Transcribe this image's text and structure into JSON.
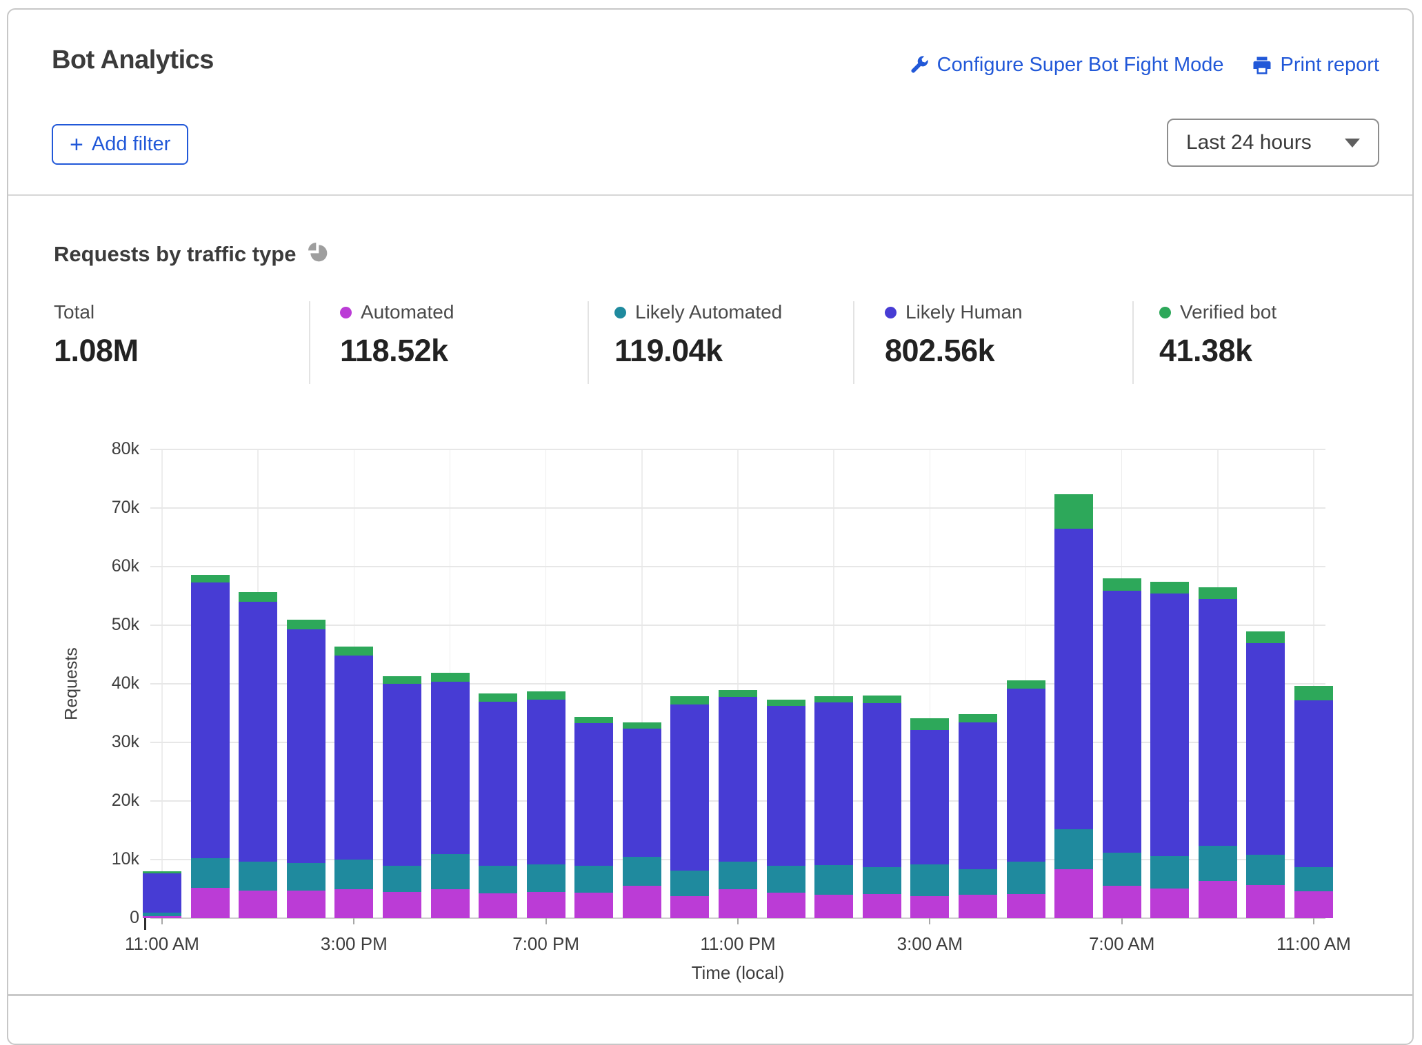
{
  "card": {
    "title": "Bot Analytics",
    "actions": [
      {
        "icon": "wrench-icon",
        "label": "Configure Super Bot Fight Mode"
      },
      {
        "icon": "printer-icon",
        "label": "Print report"
      }
    ],
    "add_filter": {
      "icon": "plus-icon",
      "plus": "+",
      "label": "Add filter"
    },
    "time_range_selector": {
      "value": "Last 24 hours",
      "icon": "chevron-down-icon"
    }
  },
  "section": {
    "title": "Requests by traffic type",
    "icon": "pie-chart-icon"
  },
  "stats": [
    {
      "label": "Total",
      "value": "1.08M",
      "color": null
    },
    {
      "label": "Automated",
      "value": "118.52k",
      "color": "#bb3cd6"
    },
    {
      "label": "Likely Automated",
      "value": "119.04k",
      "color": "#1f8a9e"
    },
    {
      "label": "Likely Human",
      "value": "802.56k",
      "color": "#473cd4"
    },
    {
      "label": "Verified bot",
      "value": "41.38k",
      "color": "#2da85a"
    }
  ],
  "chart_data": {
    "type": "bar",
    "stacked": true,
    "title": "Requests by traffic type",
    "xlabel": "Time (local)",
    "ylabel": "Requests",
    "ylim": [
      0,
      80000
    ],
    "grid": true,
    "legend_position": "top-stats-row",
    "ytick_labels": [
      "0",
      "10k",
      "20k",
      "30k",
      "40k",
      "50k",
      "60k",
      "70k",
      "80k"
    ],
    "xtick_labels": [
      "11:00 AM",
      "3:00 PM",
      "7:00 PM",
      "11:00 PM",
      "3:00 AM",
      "7:00 AM",
      "11:00 AM"
    ],
    "series_order": [
      "automated",
      "likely_automated",
      "likely_human",
      "verified_bot"
    ],
    "series": [
      {
        "key": "automated",
        "name": "Automated",
        "color": "#bb3cd6",
        "total": "118.52k"
      },
      {
        "key": "likely_automated",
        "name": "Likely Automated",
        "color": "#1f8a9e",
        "total": "119.04k"
      },
      {
        "key": "likely_human",
        "name": "Likely Human",
        "color": "#473cd4",
        "total": "802.56k"
      },
      {
        "key": "verified_bot",
        "name": "Verified bot",
        "color": "#2da85a",
        "total": "41.38k"
      }
    ],
    "total_label": "Total",
    "total_value": "1.08M",
    "bars": [
      {
        "automated": 400,
        "likely_automated": 600,
        "likely_human": 6700,
        "verified_bot": 300
      },
      {
        "automated": 5200,
        "likely_automated": 5000,
        "likely_human": 47100,
        "verified_bot": 1300
      },
      {
        "automated": 4700,
        "likely_automated": 5000,
        "likely_human": 44300,
        "verified_bot": 1600
      },
      {
        "automated": 4700,
        "likely_automated": 4700,
        "likely_human": 39900,
        "verified_bot": 1700
      },
      {
        "automated": 4900,
        "likely_automated": 5100,
        "likely_human": 34800,
        "verified_bot": 1500
      },
      {
        "automated": 4500,
        "likely_automated": 4400,
        "likely_human": 31100,
        "verified_bot": 1300
      },
      {
        "automated": 5000,
        "likely_automated": 5900,
        "likely_human": 29400,
        "verified_bot": 1600
      },
      {
        "automated": 4200,
        "likely_automated": 4800,
        "likely_human": 28000,
        "verified_bot": 1400
      },
      {
        "automated": 4500,
        "likely_automated": 4700,
        "likely_human": 28100,
        "verified_bot": 1400
      },
      {
        "automated": 4400,
        "likely_automated": 4600,
        "likely_human": 24300,
        "verified_bot": 1100
      },
      {
        "automated": 5500,
        "likely_automated": 5000,
        "likely_human": 21900,
        "verified_bot": 1000
      },
      {
        "automated": 3800,
        "likely_automated": 4300,
        "likely_human": 28400,
        "verified_bot": 1400
      },
      {
        "automated": 4900,
        "likely_automated": 4700,
        "likely_human": 28200,
        "verified_bot": 1100
      },
      {
        "automated": 4400,
        "likely_automated": 4500,
        "likely_human": 27300,
        "verified_bot": 1100
      },
      {
        "automated": 4000,
        "likely_automated": 5100,
        "likely_human": 27700,
        "verified_bot": 1100
      },
      {
        "automated": 4100,
        "likely_automated": 4600,
        "likely_human": 28000,
        "verified_bot": 1300
      },
      {
        "automated": 3800,
        "likely_automated": 5400,
        "likely_human": 22900,
        "verified_bot": 2000
      },
      {
        "automated": 4000,
        "likely_automated": 4300,
        "likely_human": 25100,
        "verified_bot": 1400
      },
      {
        "automated": 4100,
        "likely_automated": 5500,
        "likely_human": 29600,
        "verified_bot": 1400
      },
      {
        "automated": 8400,
        "likely_automated": 6800,
        "likely_human": 51300,
        "verified_bot": 5900
      },
      {
        "automated": 5500,
        "likely_automated": 5700,
        "likely_human": 44700,
        "verified_bot": 2100
      },
      {
        "automated": 5100,
        "likely_automated": 5500,
        "likely_human": 44800,
        "verified_bot": 2000
      },
      {
        "automated": 6300,
        "likely_automated": 6000,
        "likely_human": 42200,
        "verified_bot": 2000
      },
      {
        "automated": 5700,
        "likely_automated": 5100,
        "likely_human": 36100,
        "verified_bot": 2100
      },
      {
        "automated": 4600,
        "likely_automated": 4100,
        "likely_human": 28500,
        "verified_bot": 2400
      }
    ]
  }
}
